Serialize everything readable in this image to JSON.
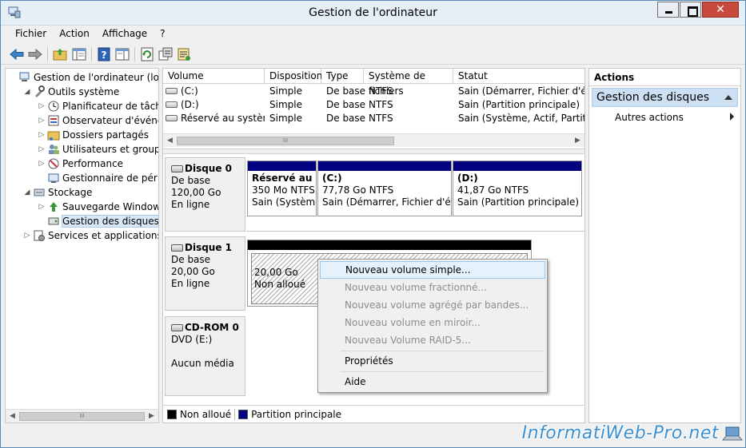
{
  "window": {
    "title": "Gestion de l'ordinateur"
  },
  "menu": [
    "Fichier",
    "Action",
    "Affichage",
    "?"
  ],
  "tree": [
    {
      "label": "Gestion de l'ordinateur (local)",
      "level": 0,
      "expander": "",
      "icon": "computer-icon"
    },
    {
      "label": "Outils système",
      "level": 1,
      "expander": "◢",
      "icon": "tools-icon"
    },
    {
      "label": "Planificateur de tâches",
      "level": 2,
      "expander": "▷",
      "icon": "clock-icon"
    },
    {
      "label": "Observateur d'événeme",
      "level": 2,
      "expander": "▷",
      "icon": "event-viewer-icon"
    },
    {
      "label": "Dossiers partagés",
      "level": 2,
      "expander": "▷",
      "icon": "shared-folder-icon"
    },
    {
      "label": "Utilisateurs et groupes l",
      "level": 2,
      "expander": "▷",
      "icon": "users-icon"
    },
    {
      "label": "Performance",
      "level": 2,
      "expander": "▷",
      "icon": "performance-icon"
    },
    {
      "label": "Gestionnaire de périphé",
      "level": 2,
      "expander": "",
      "icon": "device-manager-icon"
    },
    {
      "label": "Stockage",
      "level": 1,
      "expander": "◢",
      "icon": "storage-icon"
    },
    {
      "label": "Sauvegarde Windows Se",
      "level": 2,
      "expander": "▷",
      "icon": "backup-icon"
    },
    {
      "label": "Gestion des disques",
      "level": 2,
      "expander": "",
      "icon": "disk-management-icon",
      "selected": true
    },
    {
      "label": "Services et applications",
      "level": 1,
      "expander": "▷",
      "icon": "services-icon"
    }
  ],
  "volumes": {
    "columns": [
      "Volume",
      "Disposition",
      "Type",
      "Système de fichiers",
      "Statut"
    ],
    "rows": [
      [
        "(C:)",
        "Simple",
        "De base",
        "NTFS",
        "Sain (Démarrer, Fichier d'écha"
      ],
      [
        "(D:)",
        "Simple",
        "De base",
        "NTFS",
        "Sain (Partition principale)"
      ],
      [
        "Réservé au système",
        "Simple",
        "De base",
        "NTFS",
        "Sain (Système, Actif, Partition"
      ]
    ]
  },
  "disks": [
    {
      "name": "Disque 0",
      "lines": [
        "De base",
        "120,00 Go",
        "En ligne"
      ],
      "partitions": [
        {
          "name": "Réservé au sy",
          "size": "350 Mo NTFS",
          "status": "Sain (Système"
        },
        {
          "name": "(C:)",
          "size": "77,78 Go NTFS",
          "status": "Sain (Démarrer, Fichier d'écha"
        },
        {
          "name": "(D:)",
          "size": "41,87 Go NTFS",
          "status": "Sain (Partition principale)"
        }
      ]
    },
    {
      "name": "Disque 1",
      "lines": [
        "De base",
        "20,00 Go",
        "En ligne"
      ],
      "partitions": [
        {
          "name": "",
          "size": "20,00 Go",
          "status": "Non alloué"
        }
      ]
    },
    {
      "name": "CD-ROM 0",
      "lines": [
        "DVD (E:)",
        "",
        "Aucun média"
      ],
      "partitions": []
    }
  ],
  "legend": [
    {
      "label": "Non alloué",
      "color": "#000000"
    },
    {
      "label": "Partition principale",
      "color": "#000080"
    }
  ],
  "actions": {
    "header": "Actions",
    "selected": "Gestion des disques",
    "more": "Autres actions"
  },
  "context_menu": [
    {
      "label": "Nouveau volume simple...",
      "enabled": true,
      "highlighted": true
    },
    {
      "label": "Nouveau volume fractionné...",
      "enabled": false
    },
    {
      "label": "Nouveau volume agrégé par bandes...",
      "enabled": false
    },
    {
      "label": "Nouveau volume en miroir...",
      "enabled": false
    },
    {
      "label": "Nouveau Volume RAID-5...",
      "enabled": false
    },
    {
      "label": "Propriétés",
      "enabled": true
    },
    {
      "label": "Aide",
      "enabled": true
    }
  ],
  "watermark": "InformatiWeb-Pro.net"
}
